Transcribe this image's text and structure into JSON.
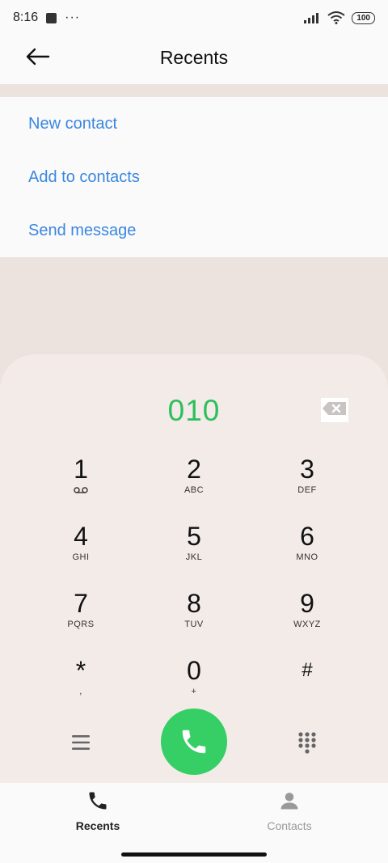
{
  "status_bar": {
    "time": "8:16",
    "overflow": "···",
    "battery": "100",
    "icons": [
      "square-notification-icon",
      "signal-icon",
      "wifi-icon",
      "battery-icon"
    ]
  },
  "header": {
    "title": "Recents",
    "back_icon": "arrow-left-icon"
  },
  "menu": {
    "items": [
      {
        "label": "New contact"
      },
      {
        "label": "Add to contacts"
      },
      {
        "label": "Send message"
      }
    ]
  },
  "dialer": {
    "number": "010",
    "backspace_icon": "backspace-icon",
    "keys": [
      {
        "digit": "1",
        "letters": "",
        "sub_icon": "voicemail-icon"
      },
      {
        "digit": "2",
        "letters": "ABC"
      },
      {
        "digit": "3",
        "letters": "DEF"
      },
      {
        "digit": "4",
        "letters": "GHI"
      },
      {
        "digit": "5",
        "letters": "JKL"
      },
      {
        "digit": "6",
        "letters": "MNO"
      },
      {
        "digit": "7",
        "letters": "PQRS"
      },
      {
        "digit": "8",
        "letters": "TUV"
      },
      {
        "digit": "9",
        "letters": "WXYZ"
      },
      {
        "digit": "*",
        "letters": ","
      },
      {
        "digit": "0",
        "letters": "+"
      },
      {
        "digit": "#",
        "letters": ""
      }
    ],
    "menu_icon": "hamburger-menu-icon",
    "call_icon": "phone-icon",
    "keypad_icon": "dialpad-icon"
  },
  "nav": {
    "recents": {
      "label": "Recents",
      "icon": "phone-icon"
    },
    "contacts": {
      "label": "Contacts",
      "icon": "person-icon"
    }
  },
  "colors": {
    "accent_blue": "#3a87e0",
    "call_green": "#35cf66",
    "number_green": "#2dbf5c",
    "dialer_bg": "#f2ebe8"
  }
}
